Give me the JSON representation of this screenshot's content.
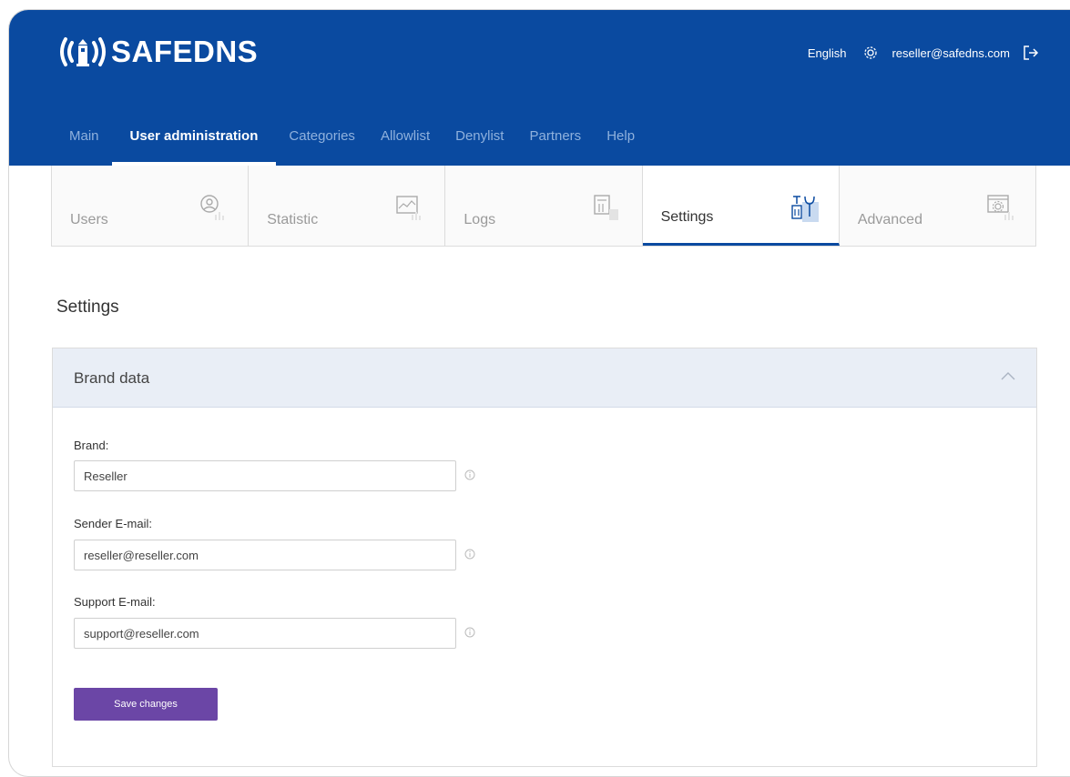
{
  "brand": {
    "name": "SAFEDNS"
  },
  "header": {
    "language": "English",
    "user_email": "reseller@safedns.com"
  },
  "nav": {
    "items": [
      {
        "label": "Main"
      },
      {
        "label": "User administration",
        "active": true
      },
      {
        "label": "Categories"
      },
      {
        "label": "Allowlist"
      },
      {
        "label": "Denylist"
      },
      {
        "label": "Partners"
      },
      {
        "label": "Help"
      }
    ]
  },
  "subtabs": [
    {
      "label": "Users",
      "icon": "user-icon"
    },
    {
      "label": "Statistic",
      "icon": "chart-icon"
    },
    {
      "label": "Logs",
      "icon": "logs-icon"
    },
    {
      "label": "Settings",
      "icon": "tools-icon",
      "active": true
    },
    {
      "label": "Advanced",
      "icon": "advanced-settings-icon"
    }
  ],
  "page": {
    "title": "Settings"
  },
  "panel": {
    "title": "Brand data",
    "fields": [
      {
        "label": "Brand:",
        "value": "Reseller"
      },
      {
        "label": "Sender E-mail:",
        "value": "reseller@reseller.com"
      },
      {
        "label": "Support E-mail:",
        "value": "support@reseller.com"
      }
    ],
    "save_label": "Save changes"
  },
  "colors": {
    "header_bg": "#0a4aa0",
    "button_bg": "#6b46a6",
    "panel_header_bg": "#e9eef6"
  }
}
